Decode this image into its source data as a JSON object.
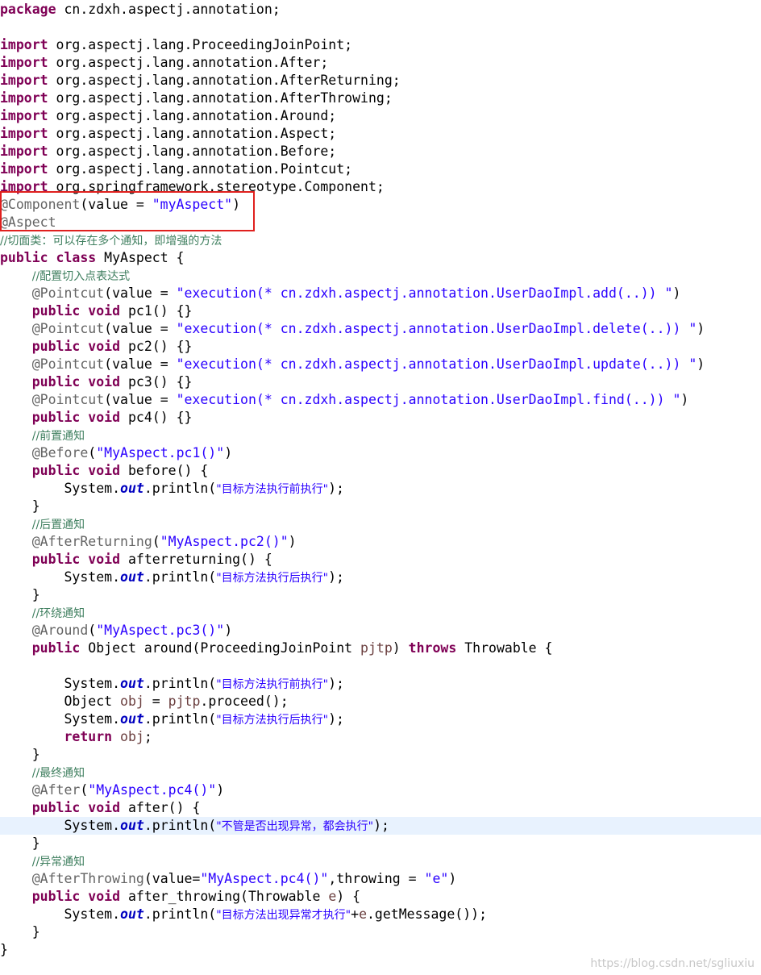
{
  "code": {
    "lines": [
      [
        {
          "t": "package",
          "c": "kw"
        },
        {
          "t": " cn.zdxh.aspectj.annotation;"
        }
      ],
      [],
      [
        {
          "t": "import",
          "c": "kw"
        },
        {
          "t": " org.aspectj.lang.ProceedingJoinPoint;"
        }
      ],
      [
        {
          "t": "import",
          "c": "kw"
        },
        {
          "t": " org.aspectj.lang.annotation.After;"
        }
      ],
      [
        {
          "t": "import",
          "c": "kw"
        },
        {
          "t": " org.aspectj.lang.annotation.AfterReturning;"
        }
      ],
      [
        {
          "t": "import",
          "c": "kw"
        },
        {
          "t": " org.aspectj.lang.annotation.AfterThrowing;"
        }
      ],
      [
        {
          "t": "import",
          "c": "kw"
        },
        {
          "t": " org.aspectj.lang.annotation.Around;"
        }
      ],
      [
        {
          "t": "import",
          "c": "kw"
        },
        {
          "t": " org.aspectj.lang.annotation.Aspect;"
        }
      ],
      [
        {
          "t": "import",
          "c": "kw"
        },
        {
          "t": " org.aspectj.lang.annotation.Before;"
        }
      ],
      [
        {
          "t": "import",
          "c": "kw"
        },
        {
          "t": " org.aspectj.lang.annotation.Pointcut;"
        }
      ],
      [
        {
          "t": "import",
          "c": "kw"
        },
        {
          "t": " org.springframework.stereotype.Component;"
        }
      ],
      [
        {
          "t": "@Component",
          "c": "an"
        },
        {
          "t": "(value = "
        },
        {
          "t": "\"myAspect\"",
          "c": "str"
        },
        {
          "t": ")"
        }
      ],
      [
        {
          "t": "@Aspect",
          "c": "an"
        }
      ],
      [
        {
          "t": "//切面类：可以存在多个通知，即增强的方法",
          "c": "cm"
        }
      ],
      [
        {
          "t": "public",
          "c": "kw"
        },
        {
          "t": " "
        },
        {
          "t": "class",
          "c": "kw"
        },
        {
          "t": " MyAspect {"
        }
      ],
      [
        {
          "t": "    "
        },
        {
          "t": "//配置切入点表达式",
          "c": "cm"
        }
      ],
      [
        {
          "t": "    "
        },
        {
          "t": "@Pointcut",
          "c": "an"
        },
        {
          "t": "(value = "
        },
        {
          "t": "\"execution(* cn.zdxh.aspectj.annotation.UserDaoImpl.add(..)) \"",
          "c": "str"
        },
        {
          "t": ")"
        }
      ],
      [
        {
          "t": "    "
        },
        {
          "t": "public",
          "c": "kw"
        },
        {
          "t": " "
        },
        {
          "t": "void",
          "c": "kw"
        },
        {
          "t": " pc1() {}"
        }
      ],
      [
        {
          "t": "    "
        },
        {
          "t": "@Pointcut",
          "c": "an"
        },
        {
          "t": "(value = "
        },
        {
          "t": "\"execution(* cn.zdxh.aspectj.annotation.UserDaoImpl.delete(..)) \"",
          "c": "str"
        },
        {
          "t": ")"
        }
      ],
      [
        {
          "t": "    "
        },
        {
          "t": "public",
          "c": "kw"
        },
        {
          "t": " "
        },
        {
          "t": "void",
          "c": "kw"
        },
        {
          "t": " pc2() {}"
        }
      ],
      [
        {
          "t": "    "
        },
        {
          "t": "@Pointcut",
          "c": "an"
        },
        {
          "t": "(value = "
        },
        {
          "t": "\"execution(* cn.zdxh.aspectj.annotation.UserDaoImpl.update(..)) \"",
          "c": "str"
        },
        {
          "t": ")"
        }
      ],
      [
        {
          "t": "    "
        },
        {
          "t": "public",
          "c": "kw"
        },
        {
          "t": " "
        },
        {
          "t": "void",
          "c": "kw"
        },
        {
          "t": " pc3() {}"
        }
      ],
      [
        {
          "t": "    "
        },
        {
          "t": "@Pointcut",
          "c": "an"
        },
        {
          "t": "(value = "
        },
        {
          "t": "\"execution(* cn.zdxh.aspectj.annotation.UserDaoImpl.find(..)) \"",
          "c": "str"
        },
        {
          "t": ")"
        }
      ],
      [
        {
          "t": "    "
        },
        {
          "t": "public",
          "c": "kw"
        },
        {
          "t": " "
        },
        {
          "t": "void",
          "c": "kw"
        },
        {
          "t": " pc4() {}"
        }
      ],
      [
        {
          "t": "    "
        },
        {
          "t": "//前置通知",
          "c": "cm"
        }
      ],
      [
        {
          "t": "    "
        },
        {
          "t": "@Before",
          "c": "an"
        },
        {
          "t": "("
        },
        {
          "t": "\"MyAspect.pc1()\"",
          "c": "str"
        },
        {
          "t": ")"
        }
      ],
      [
        {
          "t": "    "
        },
        {
          "t": "public",
          "c": "kw"
        },
        {
          "t": " "
        },
        {
          "t": "void",
          "c": "kw"
        },
        {
          "t": " before() {"
        }
      ],
      [
        {
          "t": "        System."
        },
        {
          "t": "out",
          "c": "fld"
        },
        {
          "t": ".println("
        },
        {
          "t": "\"目标方法执行前执行\"",
          "c": "str zh"
        },
        {
          "t": ");"
        }
      ],
      [
        {
          "t": "    }"
        }
      ],
      [
        {
          "t": "    "
        },
        {
          "t": "//后置通知",
          "c": "cm"
        }
      ],
      [
        {
          "t": "    "
        },
        {
          "t": "@AfterReturning",
          "c": "an"
        },
        {
          "t": "("
        },
        {
          "t": "\"MyAspect.pc2()\"",
          "c": "str"
        },
        {
          "t": ")"
        }
      ],
      [
        {
          "t": "    "
        },
        {
          "t": "public",
          "c": "kw"
        },
        {
          "t": " "
        },
        {
          "t": "void",
          "c": "kw"
        },
        {
          "t": " afterreturning() {"
        }
      ],
      [
        {
          "t": "        System."
        },
        {
          "t": "out",
          "c": "fld"
        },
        {
          "t": ".println("
        },
        {
          "t": "\"目标方法执行后执行\"",
          "c": "str zh"
        },
        {
          "t": ");"
        }
      ],
      [
        {
          "t": "    }"
        }
      ],
      [
        {
          "t": "    "
        },
        {
          "t": "//环绕通知",
          "c": "cm"
        }
      ],
      [
        {
          "t": "    "
        },
        {
          "t": "@Around",
          "c": "an"
        },
        {
          "t": "("
        },
        {
          "t": "\"MyAspect.pc3()\"",
          "c": "str"
        },
        {
          "t": ")"
        }
      ],
      [
        {
          "t": "    "
        },
        {
          "t": "public",
          "c": "kw"
        },
        {
          "t": " Object around(ProceedingJoinPoint "
        },
        {
          "t": "pjtp",
          "c": "par"
        },
        {
          "t": ") "
        },
        {
          "t": "throws",
          "c": "kw"
        },
        {
          "t": " Throwable {"
        }
      ],
      [],
      [
        {
          "t": "        System."
        },
        {
          "t": "out",
          "c": "fld"
        },
        {
          "t": ".println("
        },
        {
          "t": "\"目标方法执行前执行\"",
          "c": "str zh"
        },
        {
          "t": ");"
        }
      ],
      [
        {
          "t": "        Object "
        },
        {
          "t": "obj",
          "c": "par"
        },
        {
          "t": " = "
        },
        {
          "t": "pjtp",
          "c": "par"
        },
        {
          "t": ".proceed();"
        }
      ],
      [
        {
          "t": "        System."
        },
        {
          "t": "out",
          "c": "fld"
        },
        {
          "t": ".println("
        },
        {
          "t": "\"目标方法执行后执行\"",
          "c": "str zh"
        },
        {
          "t": ");"
        }
      ],
      [
        {
          "t": "        "
        },
        {
          "t": "return",
          "c": "kw"
        },
        {
          "t": " "
        },
        {
          "t": "obj",
          "c": "par"
        },
        {
          "t": ";"
        }
      ],
      [
        {
          "t": "    }"
        }
      ],
      [
        {
          "t": "    "
        },
        {
          "t": "//最终通知",
          "c": "cm"
        }
      ],
      [
        {
          "t": "    "
        },
        {
          "t": "@After",
          "c": "an"
        },
        {
          "t": "("
        },
        {
          "t": "\"MyAspect.pc4()\"",
          "c": "str"
        },
        {
          "t": ")"
        }
      ],
      [
        {
          "t": "    "
        },
        {
          "t": "public",
          "c": "kw"
        },
        {
          "t": " "
        },
        {
          "t": "void",
          "c": "kw"
        },
        {
          "t": " after() {"
        }
      ],
      [
        {
          "t": "        System."
        },
        {
          "t": "out",
          "c": "fld"
        },
        {
          "t": ".println("
        },
        {
          "t": "\"不管是否出现异常，都会执行\"",
          "c": "str zh"
        },
        {
          "t": ");"
        }
      ],
      [
        {
          "t": "    }"
        }
      ],
      [
        {
          "t": "    "
        },
        {
          "t": "//异常通知",
          "c": "cm"
        }
      ],
      [
        {
          "t": "    "
        },
        {
          "t": "@AfterThrowing",
          "c": "an"
        },
        {
          "t": "(value="
        },
        {
          "t": "\"MyAspect.pc4()\"",
          "c": "str"
        },
        {
          "t": ",throwing = "
        },
        {
          "t": "\"e\"",
          "c": "str"
        },
        {
          "t": ")"
        }
      ],
      [
        {
          "t": "    "
        },
        {
          "t": "public",
          "c": "kw"
        },
        {
          "t": " "
        },
        {
          "t": "void",
          "c": "kw"
        },
        {
          "t": " after_throwing(Throwable "
        },
        {
          "t": "e",
          "c": "par"
        },
        {
          "t": ") {"
        }
      ],
      [
        {
          "t": "        System."
        },
        {
          "t": "out",
          "c": "fld"
        },
        {
          "t": ".println("
        },
        {
          "t": "\"目标方法出现异常才执行\"",
          "c": "str zh"
        },
        {
          "t": "+"
        },
        {
          "t": "e",
          "c": "par"
        },
        {
          "t": ".getMessage());"
        }
      ],
      [
        {
          "t": "    }"
        }
      ],
      [
        {
          "t": "}"
        }
      ]
    ],
    "highlighted_line": 46
  },
  "watermark": "https://blog.csdn.net/sgliuxiu"
}
